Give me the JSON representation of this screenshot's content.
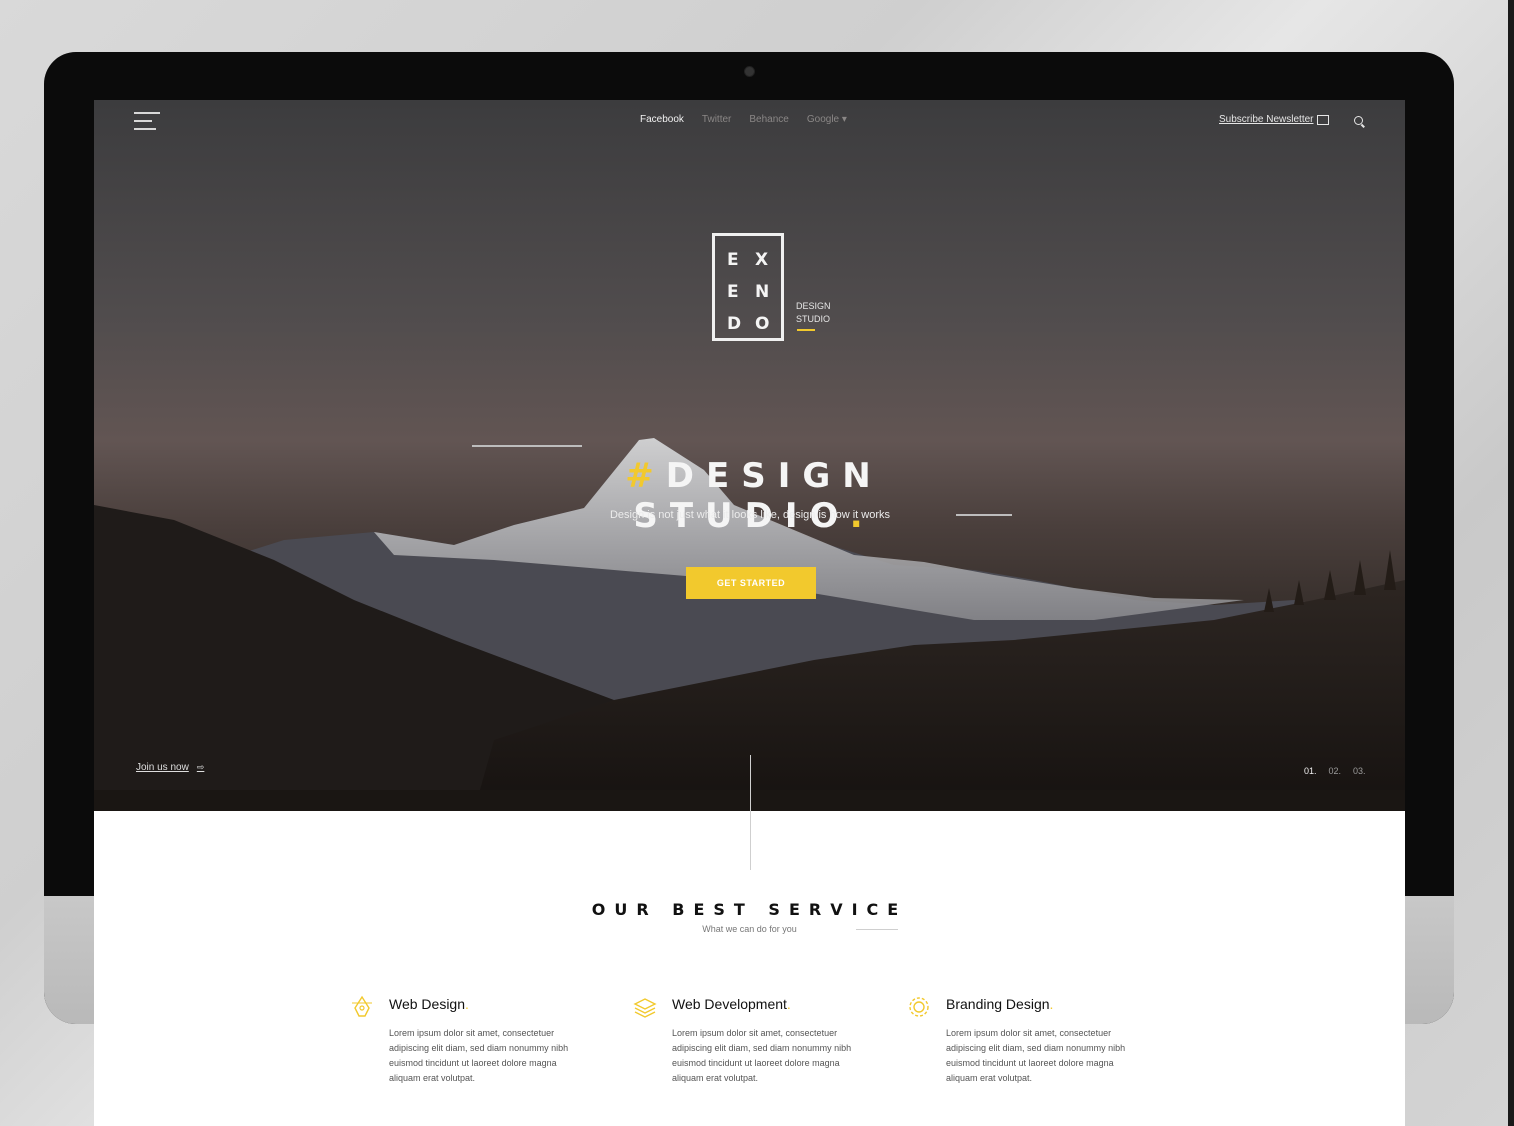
{
  "nav": {
    "links": [
      "Facebook",
      "Twitter",
      "Behance",
      "Google ▾"
    ],
    "subscribe_label": "Subscribe Newsletter"
  },
  "logo": {
    "letters": [
      "E",
      "X",
      "E",
      "N",
      "D",
      "O"
    ],
    "sub_line1": "DESIGN",
    "sub_line2": "STUDIO"
  },
  "hero": {
    "hash": "#",
    "title": "DESIGN STUDIO",
    "title_dot": ".",
    "subtitle": "Design is not just what it looks like, design is how it works",
    "cta_label": "GET STARTED",
    "join_label": "Join us now",
    "join_arrow": "⇨",
    "pager": [
      "01.",
      "02.",
      "03."
    ]
  },
  "services": {
    "title": "OUR BEST SERVICE",
    "subtitle": "What we can do for you",
    "items": [
      {
        "title": "Web Design",
        "dot": ".",
        "icon": "pen-tool-icon",
        "text": "Lorem ipsum dolor sit amet, consectetuer adipiscing elit diam, sed diam nonummy nibh euismod tincidunt ut laoreet dolore magna aliquam erat volutpat."
      },
      {
        "title": "Web Development",
        "dot": ".",
        "icon": "layers-icon",
        "text": "Lorem ipsum dolor sit amet, consectetuer adipiscing elit diam, sed diam nonummy nibh euismod tincidunt ut laoreet dolore magna aliquam erat volutpat."
      },
      {
        "title": "Branding Design",
        "dot": ".",
        "icon": "gear-icon",
        "text": "Lorem ipsum dolor sit amet, consectetuer adipiscing elit diam, sed diam nonummy nibh euismod tincidunt ut laoreet dolore magna aliquam erat volutpat."
      }
    ]
  },
  "colors": {
    "accent": "#f2c92d",
    "text_dark": "#111111"
  }
}
